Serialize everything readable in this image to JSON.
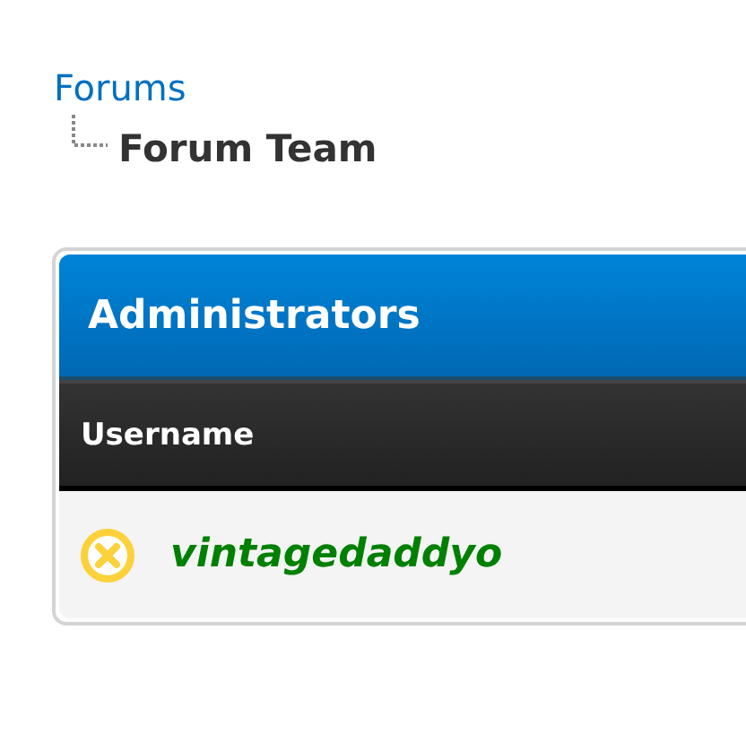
{
  "breadcrumb": {
    "parent": "Forums",
    "current": "Forum Team"
  },
  "group": {
    "title": "Administrators",
    "columns": [
      "Username"
    ],
    "members": [
      {
        "username": "vintagedaddyo",
        "online": false,
        "color": "#008000"
      }
    ]
  }
}
